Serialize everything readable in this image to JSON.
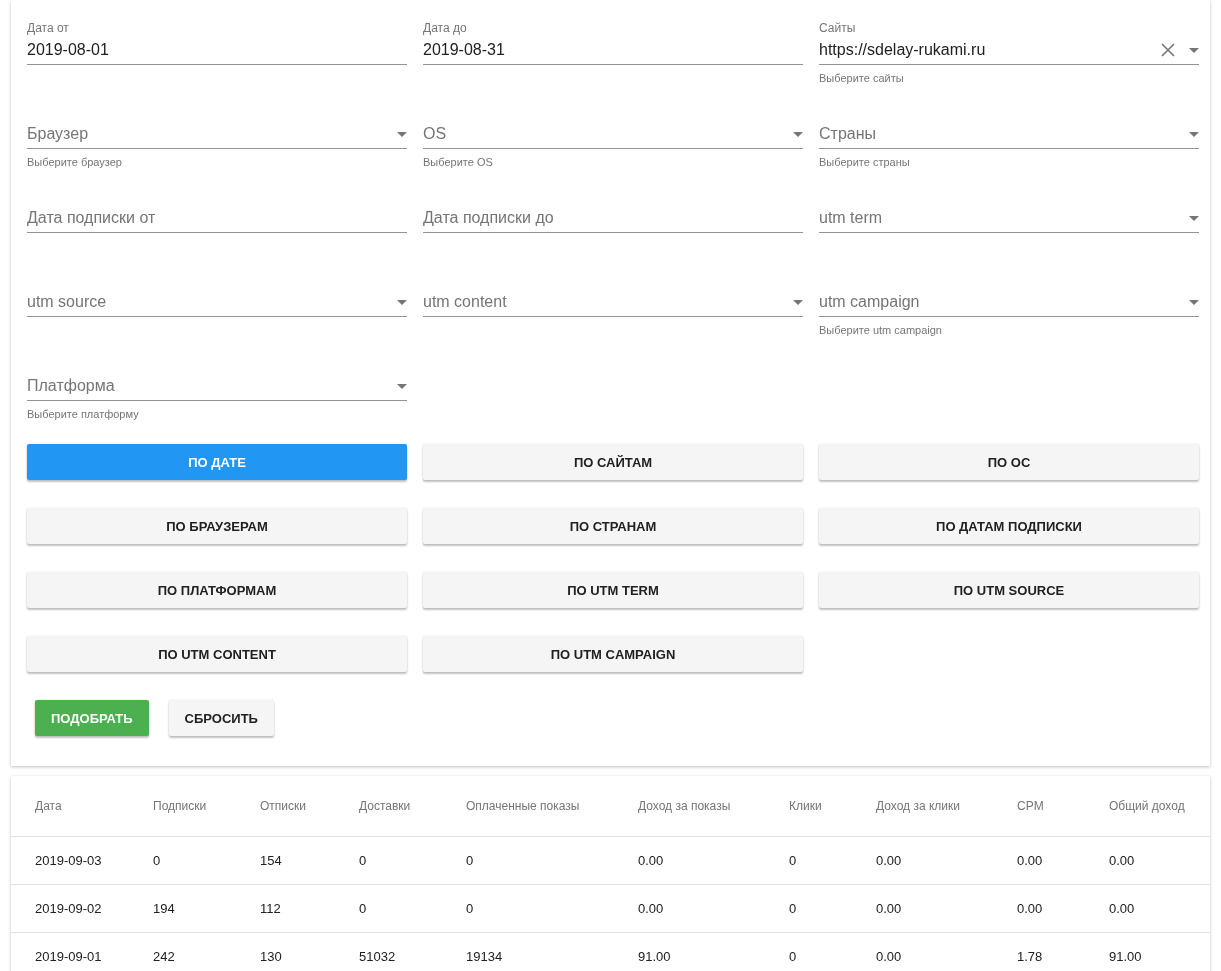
{
  "filters": [
    {
      "kind": "text",
      "label": "Дата от",
      "value": "2019-08-01"
    },
    {
      "kind": "text",
      "label": "Дата до",
      "value": "2019-08-31"
    },
    {
      "kind": "select",
      "label": "Сайты",
      "value": "https://sdelay-rukami.ru",
      "hint": "Выберите сайты",
      "clearable": true
    },
    {
      "kind": "select",
      "placeholder": "Браузер",
      "hint": "Выберите браузер"
    },
    {
      "kind": "select",
      "placeholder": "OS",
      "hint": "Выберите OS"
    },
    {
      "kind": "select",
      "placeholder": "Страны",
      "hint": "Выберите страны"
    },
    {
      "kind": "text",
      "placeholder": "Дата подписки от"
    },
    {
      "kind": "text",
      "placeholder": "Дата подписки до"
    },
    {
      "kind": "select",
      "placeholder": "utm term"
    },
    {
      "kind": "select",
      "placeholder": "utm source"
    },
    {
      "kind": "select",
      "placeholder": "utm content"
    },
    {
      "kind": "select",
      "placeholder": "utm campaign",
      "hint": "Выберите utm campaign"
    },
    {
      "kind": "select",
      "placeholder": "Платформа",
      "hint": "Выберите платформу"
    }
  ],
  "group_buttons": [
    {
      "label": "ПО ДАТЕ",
      "selected": true
    },
    {
      "label": "ПО САЙТАМ",
      "selected": false
    },
    {
      "label": "ПО ОС",
      "selected": false
    },
    {
      "label": "ПО БРАУЗЕРАМ",
      "selected": false
    },
    {
      "label": "ПО СТРАНАМ",
      "selected": false
    },
    {
      "label": "ПО ДАТАМ ПОДПИСКИ",
      "selected": false
    },
    {
      "label": "ПО ПЛАТФОРМАМ",
      "selected": false
    },
    {
      "label": "ПО UTM TERM",
      "selected": false
    },
    {
      "label": "ПО UTM SOURCE",
      "selected": false
    },
    {
      "label": "ПО UTM CONTENT",
      "selected": false
    },
    {
      "label": "ПО UTM CAMPAIGN",
      "selected": false
    }
  ],
  "actions": [
    {
      "label": "ПОДОБРАТЬ",
      "kind": "primary"
    },
    {
      "label": "СБРОСИТЬ",
      "kind": "default"
    }
  ],
  "table": {
    "columns": [
      "Дата",
      "Подписки",
      "Отписки",
      "Доставки",
      "Оплаченные показы",
      "Доход за показы",
      "Клики",
      "Доход за клики",
      "CPM",
      "Общий доход"
    ],
    "rows": [
      [
        "2019-09-03",
        "0",
        "154",
        "0",
        "0",
        "0.00",
        "0",
        "0.00",
        "0.00",
        "0.00"
      ],
      [
        "2019-09-02",
        "194",
        "112",
        "0",
        "0",
        "0.00",
        "0",
        "0.00",
        "0.00",
        "0.00"
      ],
      [
        "2019-09-01",
        "242",
        "130",
        "51032",
        "19134",
        "91.00",
        "0",
        "0.00",
        "1.78",
        "91.00"
      ]
    ]
  }
}
